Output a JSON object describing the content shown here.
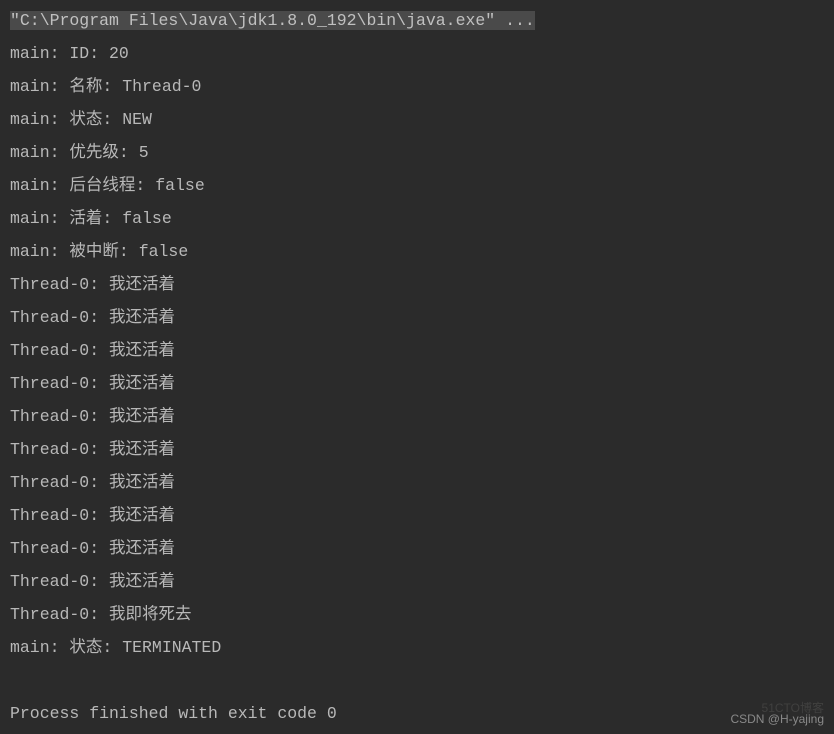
{
  "command": "\"C:\\Program Files\\Java\\jdk1.8.0_192\\bin\\java.exe\" ...",
  "lines": [
    "main: ID: 20",
    "main: 名称: Thread-0",
    "main: 状态: NEW",
    "main: 优先级: 5",
    "main: 后台线程: false",
    "main: 活着: false",
    "main: 被中断: false",
    "Thread-0: 我还活着",
    "Thread-0: 我还活着",
    "Thread-0: 我还活着",
    "Thread-0: 我还活着",
    "Thread-0: 我还活着",
    "Thread-0: 我还活着",
    "Thread-0: 我还活着",
    "Thread-0: 我还活着",
    "Thread-0: 我还活着",
    "Thread-0: 我还活着",
    "Thread-0: 我即将死去",
    "main: 状态: TERMINATED"
  ],
  "exitLine": "Process finished with exit code 0",
  "watermark1": "CSDN @H-yajing",
  "watermark2": "51CTO博客"
}
